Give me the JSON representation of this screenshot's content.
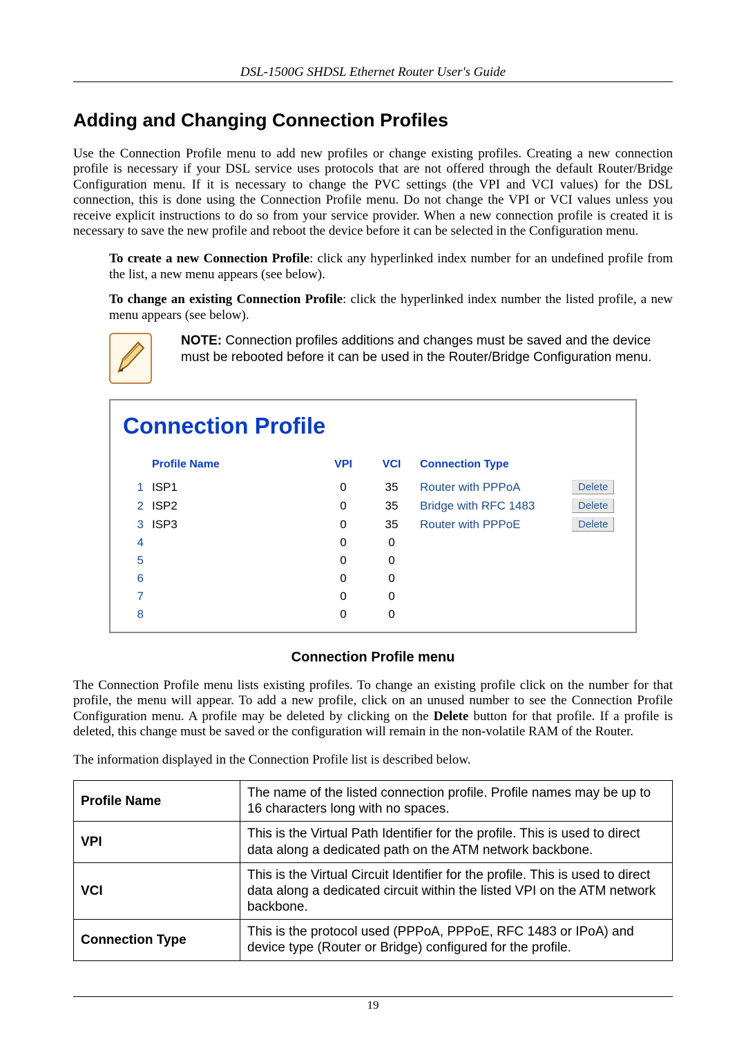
{
  "header": "DSL-1500G SHDSL Ethernet Router User's Guide",
  "section_title": "Adding and Changing Connection Profiles",
  "intro": "Use the Connection Profile menu to add new profiles or change existing profiles. Creating a new connection profile is necessary if your DSL service uses protocols that are not offered through the default Router/Bridge Configuration menu. If it is necessary to change the PVC settings (the VPI and VCI values) for the DSL connection, this is done using the Connection Profile menu. Do not change the VPI or VCI values unless you receive explicit instructions to do so from your service provider. When a new connection profile is created it is necessary to save the new profile and reboot the device before it can be selected in the Configuration menu.",
  "create_label": "To create a new Connection Profile",
  "create_text": ": click any hyperlinked index number for an undefined profile from the list, a new menu appears (see below).",
  "change_label": "To change an existing Connection Profile",
  "change_text": ": click the hyperlinked index number the listed profile, a new menu appears (see below).",
  "note_label": "NOTE:",
  "note_text": " Connection profiles additions and changes must be saved and the device must be rebooted before it can be used in the Router/Bridge Configuration menu.",
  "panel": {
    "title": "Connection Profile",
    "headers": {
      "name": "Profile Name",
      "vpi": "VPI",
      "vci": "VCI",
      "ctype": "Connection Type"
    },
    "delete_label": "Delete",
    "rows": [
      {
        "idx": "1",
        "name": "ISP1",
        "vpi": "0",
        "vci": "35",
        "ctype": "Router with PPPoA",
        "has_delete": true
      },
      {
        "idx": "2",
        "name": "ISP2",
        "vpi": "0",
        "vci": "35",
        "ctype": "Bridge with RFC 1483",
        "has_delete": true
      },
      {
        "idx": "3",
        "name": "ISP3",
        "vpi": "0",
        "vci": "35",
        "ctype": "Router with PPPoE",
        "has_delete": true
      },
      {
        "idx": "4",
        "name": "",
        "vpi": "0",
        "vci": "0",
        "ctype": "",
        "has_delete": false
      },
      {
        "idx": "5",
        "name": "",
        "vpi": "0",
        "vci": "0",
        "ctype": "",
        "has_delete": false
      },
      {
        "idx": "6",
        "name": "",
        "vpi": "0",
        "vci": "0",
        "ctype": "",
        "has_delete": false
      },
      {
        "idx": "7",
        "name": "",
        "vpi": "0",
        "vci": "0",
        "ctype": "",
        "has_delete": false
      },
      {
        "idx": "8",
        "name": "",
        "vpi": "0",
        "vci": "0",
        "ctype": "",
        "has_delete": false
      }
    ]
  },
  "caption": "Connection Profile menu",
  "para2a": "The Connection Profile menu lists existing profiles. To change an existing profile click on the number for that profile, the menu will appear. To add a new profile, click on an unused number to see the Connection Profile Configuration menu. A profile may be deleted by clicking on the ",
  "para2b": "Delete",
  "para2c": " button for that profile. If a profile is deleted, this change must be saved or the configuration will remain in the non-volatile RAM of the Router.",
  "para3": "The information displayed in the Connection Profile list is described below.",
  "desc": [
    {
      "label": "Profile Name",
      "text": "The name of the listed connection profile. Profile names may be up to 16 characters long with no spaces."
    },
    {
      "label": "VPI",
      "text": "This is the Virtual Path Identifier for the profile. This is used to direct data along a dedicated path on the ATM network backbone."
    },
    {
      "label": "VCI",
      "text": "This is the Virtual Circuit Identifier for the profile. This is used to direct data along a dedicated circuit within the listed VPI on the ATM network backbone."
    },
    {
      "label": "Connection Type",
      "text": "This is the protocol used (PPPoA, PPPoE, RFC 1483 or IPoA) and device type (Router or Bridge) configured for the profile."
    }
  ],
  "page_number": "19"
}
